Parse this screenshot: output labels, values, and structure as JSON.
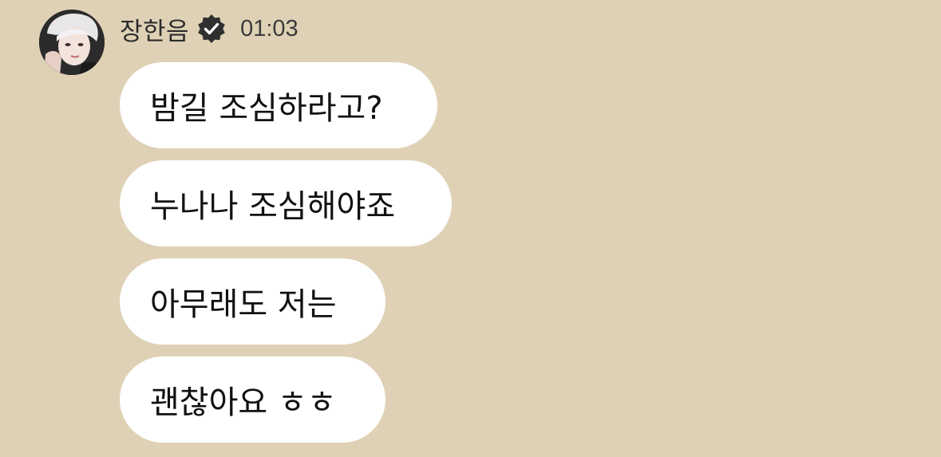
{
  "message_group": {
    "sender": {
      "name": "장한음",
      "verified_icon": "verified-badge-icon",
      "avatar_icon": "profile-photo"
    },
    "time": "01:03",
    "messages": [
      {
        "text": "밤길 조심하라고?"
      },
      {
        "text": "누나나 조심해야죠"
      },
      {
        "text": "아무래도 저는"
      },
      {
        "text": "괜찮아요 ㅎㅎ"
      }
    ]
  },
  "colors": {
    "background": "#dfd1b5",
    "bubble": "#ffffff",
    "text": "#111111",
    "badge": "#2f2f2f"
  }
}
